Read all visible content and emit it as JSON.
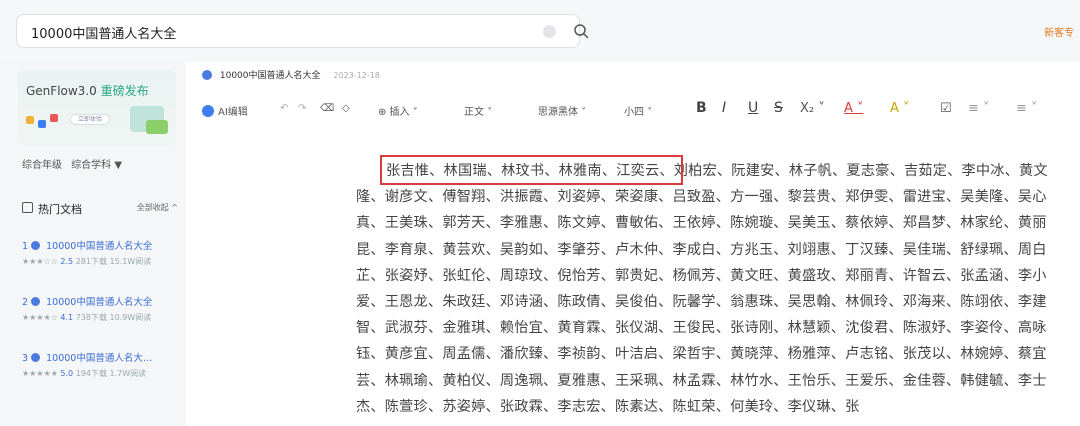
{
  "search": {
    "value": "10000中国普通人名大全",
    "clear_icon": "clear-icon",
    "search_icon": "search-icon"
  },
  "topright": {
    "label": "新客专"
  },
  "promo": {
    "title_prefix": "GenFlow3.0",
    "title_accent": "重磅发布",
    "pill": "立即体验"
  },
  "filter": {
    "grade": "综合年级",
    "subject": "综合学科 ▼"
  },
  "hot": {
    "title": "热门文档",
    "all": "全部收起 ^",
    "items": [
      {
        "index": "1",
        "name": "10000中国普通人名大全",
        "stars": "★★★☆☆",
        "score": "2.5",
        "meta": "281下载 15.1W阅读"
      },
      {
        "index": "2",
        "name": "10000中国普通人名大全",
        "stars": "★★★★☆",
        "score": "4.1",
        "meta": "738下载 10.9W阅读"
      },
      {
        "index": "3",
        "name": "10000中国普通人名大…",
        "stars": "★★★★★",
        "score": "5.0",
        "meta": "194下载 1.7W阅读"
      }
    ]
  },
  "doc": {
    "title": "10000中国普通人名大全",
    "date": "2023-12-18",
    "toolbar": {
      "ai": "AI编辑",
      "undo": "↶",
      "redo": "↷",
      "brush": "⌫",
      "clear": "◇",
      "insert": "⊕ 插入 ˅",
      "style": "正文 ˅",
      "font": "思源黑体 ˅",
      "size": "小四 ˅",
      "bold": "B",
      "italic": "I",
      "underline": "U",
      "strike": "S",
      "sub": "X₂ ˅",
      "color": "A ˅",
      "highlight": "A ˅",
      "check": "☑",
      "list": "≡ ˅",
      "list2": "≡ ˅"
    },
    "body": "张吉惟、林国瑞、林玟书、林雅南、江奕云、刘柏宏、阮建安、林子帆、夏志豪、吉茹定、李中冰、黄文隆、谢彦文、傅智翔、洪振霞、刘姿婷、荣姿康、吕致盈、方一强、黎芸贵、郑伊雯、雷进宝、吴美隆、吴心真、王美珠、郭芳天、李雅惠、陈文婷、曹敏佑、王依婷、陈婉璇、吴美玉、蔡依婷、郑昌梦、林家纶、黄丽昆、李育泉、黄芸欢、吴韵如、李肇芬、卢木仲、李成白、方兆玉、刘翊惠、丁汉臻、吴佳瑞、舒绿珮、周白芷、张姿妤、张虹伦、周琼玟、倪怡芳、郭贵妃、杨佩芳、黄文旺、黄盛玫、郑丽青、许智云、张孟涵、李小爱、王恩龙、朱政廷、邓诗涵、陈政倩、吴俊伯、阮馨学、翁惠珠、吴思翰、林佩玲、邓海来、陈翊依、李建智、武淑芬、金雅琪、赖怡宜、黄育霖、张仪湖、王俊民、张诗刚、林慧颖、沈俊君、陈淑妤、李姿伶、高咏钰、黄彦宜、周孟儒、潘欣臻、李祯韵、叶洁启、梁哲宇、黄晓萍、杨雅萍、卢志铭、张茂以、林婉婷、蔡宜芸、林珮瑜、黄柏仪、周逸珮、夏雅惠、王采珮、林孟霖、林竹水、王怡乐、王爱乐、金佳蓉、韩健毓、李士杰、陈萱珍、苏姿婷、张政霖、李志宏、陈素达、陈虹荣、何美玲、李仪琳、张"
  }
}
